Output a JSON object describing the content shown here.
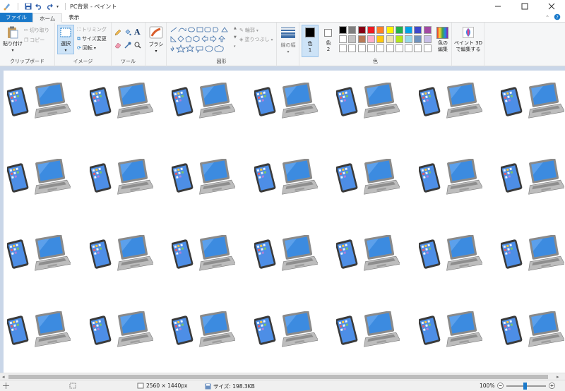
{
  "window": {
    "title": "PC背景 - ペイント"
  },
  "tabs": [
    {
      "label": "ファイル"
    },
    {
      "label": "ホーム"
    },
    {
      "label": "表示"
    }
  ],
  "clipboard": {
    "paste": "貼り付け",
    "cut": "切り取り",
    "copy": "コピー",
    "group_label": "クリップボード"
  },
  "image": {
    "select": "選択",
    "crop": "トリミング",
    "resize": "サイズ変更",
    "rotate": "回転",
    "group_label": "イメージ"
  },
  "tools": {
    "group_label": "ツール"
  },
  "brushes": {
    "label": "ブラシ"
  },
  "shapes": {
    "outline": "輪郭",
    "fill": "塗りつぶし",
    "group_label": "図形"
  },
  "size": {
    "label": "線の幅"
  },
  "colors": {
    "color1_a": "色",
    "color1_b": "1",
    "color2_a": "色",
    "color2_b": "2",
    "edit_a": "色の",
    "edit_b": "編集",
    "group_label": "色",
    "palette_row1": [
      "#000000",
      "#7f7f7f",
      "#880015",
      "#ed1c24",
      "#ff7f27",
      "#fff200",
      "#22b14c",
      "#00a2e8",
      "#3f48cc",
      "#a349a4"
    ],
    "palette_row2": [
      "#ffffff",
      "#c3c3c3",
      "#b97a57",
      "#ffaec9",
      "#ffc90e",
      "#efe4b0",
      "#b5e61d",
      "#99d9ea",
      "#7092be",
      "#c8bfe7"
    ]
  },
  "paint3d": {
    "line1": "ペイント 3D",
    "line2": "で編集する"
  },
  "status": {
    "dimensions": "2560 × 1440px",
    "filesize": "サイズ: 198.3KB",
    "zoom": "100%"
  }
}
